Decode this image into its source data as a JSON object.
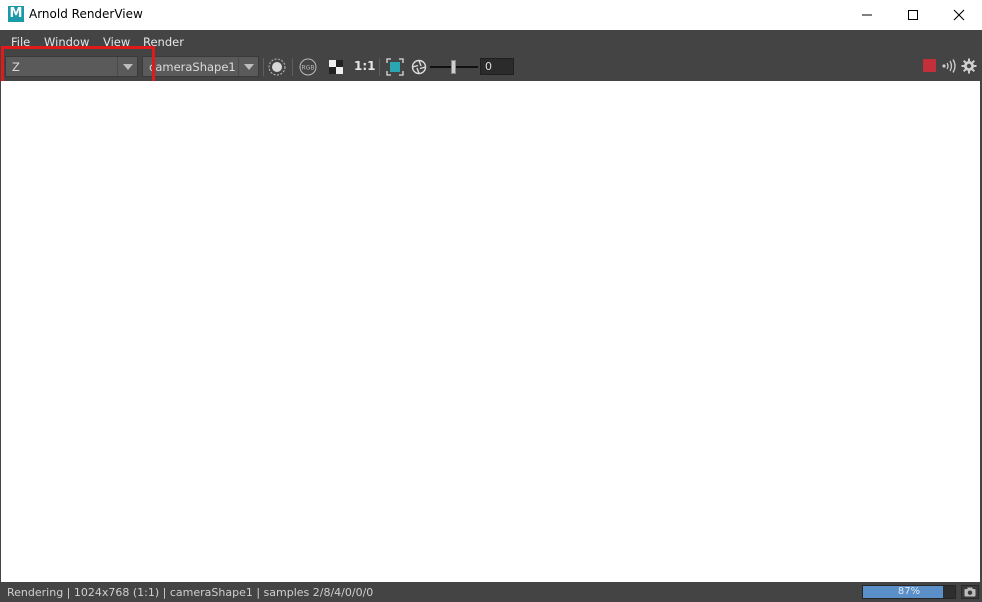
{
  "window": {
    "app_icon_letter": "M",
    "title": "Arnold RenderView"
  },
  "menu": {
    "items": [
      "File",
      "Window",
      "View",
      "Render"
    ]
  },
  "toolbar": {
    "aov_value": "Z",
    "camera_value": "cameraShape1",
    "zoom_label": "1:1",
    "slider_value": 0.5,
    "exposure_value": "0"
  },
  "status": {
    "text": "Rendering | 1024x768 (1:1) | cameraShape1 | samples 2/8/4/0/0/0",
    "progress_percent": 87,
    "progress_label": "87%"
  },
  "colors": {
    "accent_icon": "#1a9aa8",
    "stop": "#c4303a",
    "progress_fill": "#5b8fc7",
    "highlight": "#e01a1a"
  },
  "icons": [
    "maya-app-icon",
    "minimize-icon",
    "maximize-icon",
    "close-icon",
    "dropdown-arrow-icon",
    "snapshot-sphere-icon",
    "rgb-channel-icon",
    "contrast-icon",
    "frame-region-icon",
    "exposure-icon",
    "stop-icon",
    "ipr-icon",
    "gear-icon",
    "camera-icon"
  ]
}
